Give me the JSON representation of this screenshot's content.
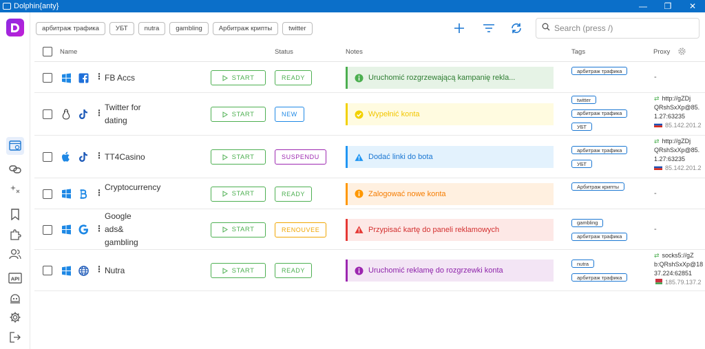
{
  "window": {
    "title": "Dolphin{anty}",
    "minimize": "—",
    "maximize": "❐",
    "close": "✕"
  },
  "filter_tags": [
    "арбитраж трафика",
    "УБТ",
    "nutra",
    "gambling",
    "Арбитраж крипты",
    "twitter"
  ],
  "search": {
    "placeholder": "Search (press /)"
  },
  "columns": {
    "name": "Name",
    "status": "Status",
    "notes": "Notes",
    "tags": "Tags",
    "proxy": "Proxy"
  },
  "start_label": "START",
  "profiles": [
    {
      "name": "FB Accs",
      "os": "windows-icon",
      "browser": "facebook-icon",
      "status": "READY",
      "status_color": "#4caf50",
      "note": "Uruchomić rozgrzewającą kampanię rekla...",
      "note_type": "success",
      "note_bg": "#e6f3e6",
      "note_border": "#4caf50",
      "note_color": "#2e7d32",
      "tags": [
        "арбитраж трафика"
      ],
      "proxy": {
        "text": "-"
      }
    },
    {
      "name": "Twitter for dating",
      "os": "linux-icon",
      "browser": "tiktok-icon",
      "status": "NEW",
      "status_color": "#1e88e5",
      "note": "Wypełnić konta",
      "note_type": "check",
      "note_bg": "#fffbe0",
      "note_border": "#f2d100",
      "note_color": "#f2c600",
      "tags": [
        "twitter",
        "арбитраж трафика",
        "УБТ"
      ],
      "proxy": {
        "line1": "http://gZDj",
        "line2": "QRshSxXp@85.",
        "line3": "1.27:63235",
        "ip": "85.142.201.2",
        "flag": "ru"
      }
    },
    {
      "name": "TT4Casino",
      "os": "apple-icon",
      "browser": "tiktok-icon",
      "status": "SUSPENDU",
      "status_color": "#9c27b0",
      "note": "Dodać linki do bota",
      "note_type": "warning",
      "note_bg": "#e3f2fd",
      "note_border": "#2196f3",
      "note_color": "#1976d2",
      "tags": [
        "арбитраж трафика",
        "УБТ"
      ],
      "proxy": {
        "line1": "http://gZDj",
        "line2": "QRshSxXp@85.",
        "line3": "1.27:63235",
        "ip": "85.142.201.2",
        "flag": "ru"
      }
    },
    {
      "name": "Cryptocurrency",
      "os": "windows-icon",
      "browser": "bitcoin-icon",
      "status": "READY",
      "status_color": "#4caf50",
      "note": "Zalogować nowe konta",
      "note_type": "info",
      "note_bg": "#fff0e0",
      "note_border": "#ff9800",
      "note_color": "#f57c00",
      "tags": [
        "Арбитраж крипты"
      ],
      "proxy": {
        "text": "-"
      }
    },
    {
      "name": "Google ads& gambling",
      "os": "windows-icon",
      "browser": "google-icon",
      "status": "RENOUVEE",
      "status_color": "#f0a500",
      "note": "Przypisać kartę do paneli reklamowych",
      "note_type": "warning",
      "note_bg": "#fde8e6",
      "note_border": "#e53935",
      "note_color": "#d32f2f",
      "tags": [
        "gambling",
        "арбитраж трафика"
      ],
      "proxy": {
        "text": "-"
      }
    },
    {
      "name": "Nutra",
      "os": "windows-icon",
      "browser": "globe-icon",
      "status": "READY",
      "status_color": "#4caf50",
      "note": "Uruchomić reklamę do rozgrzewki konta",
      "note_type": "info",
      "note_bg": "#f3e5f5",
      "note_border": "#9c27b0",
      "note_color": "#8e24aa",
      "tags": [
        "nutra",
        "арбитраж трафика"
      ],
      "proxy": {
        "line1": "socks5://gZ",
        "line2": "b:QRshSxXp@18",
        "line3": "37.224:62851",
        "ip": "185.79.137.2",
        "flag": "by"
      }
    }
  ]
}
